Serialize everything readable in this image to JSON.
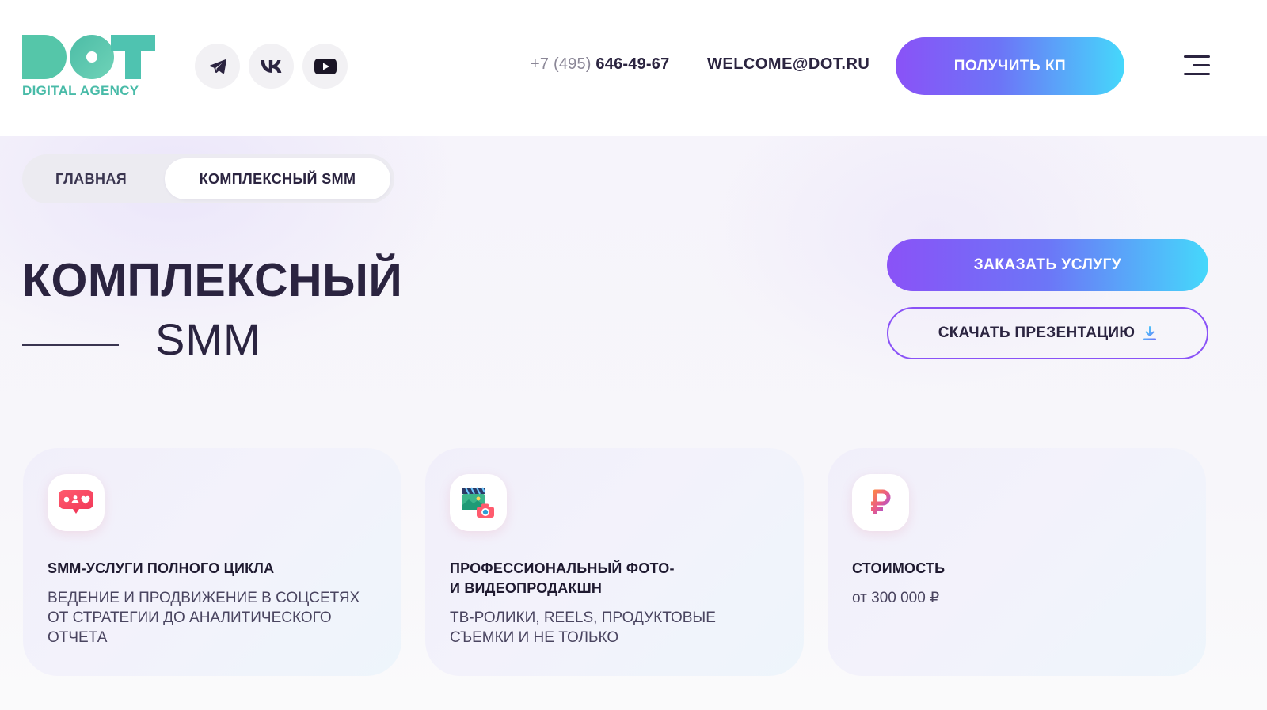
{
  "header": {
    "logo": {
      "wordmark": "DOT",
      "tagline": "DIGITAL AGENCY"
    },
    "socials": [
      {
        "name": "telegram",
        "icon": "telegram-icon"
      },
      {
        "name": "vk",
        "icon": "vk-icon"
      },
      {
        "name": "youtube",
        "icon": "youtube-icon"
      }
    ],
    "phone": {
      "code": "+7 (495)",
      "number": "646-49-67"
    },
    "email": "WELCOME@DOT.RU",
    "cta_label": "ПОЛУЧИТЬ КП",
    "menu_icon": "burger-menu-icon"
  },
  "breadcrumb": {
    "home": "ГЛАВНАЯ",
    "current": "КОМПЛЕКСНЫЙ SMM"
  },
  "hero": {
    "title_line1": "КОМПЛЕКСНЫЙ",
    "title_line2": "SMM",
    "order_label": "ЗАКАЗАТЬ УСЛУГУ",
    "download_label": "СКАЧАТЬ ПРЕЗЕНТАЦИЮ",
    "download_icon": "download-icon"
  },
  "cards": [
    {
      "icon": "social-chat-icon",
      "title": [
        "SMM-УСЛУГИ ПОЛНОГО ЦИКЛА"
      ],
      "desc": [
        "ВЕДЕНИЕ И ПРОДВИЖЕНИЕ В СОЦСЕТЯХ",
        "ОТ СТРАТЕГИИ ДО АНАЛИТИЧЕСКОГО",
        "ОТЧЕТА"
      ]
    },
    {
      "icon": "video-production-icon",
      "title": [
        "ПРОФЕССИОНАЛЬНЫЙ ФОТО-",
        "И ВИДЕОПРОДАКШН"
      ],
      "desc": [
        "ТВ-РОЛИКИ, REELS, ПРОДУКТОВЫЕ",
        "СЪЕМКИ И НЕ ТОЛЬКО"
      ]
    },
    {
      "icon": "ruble-icon",
      "title": [
        "СТОИМОСТЬ"
      ],
      "desc": [
        "от 300 000 ₽"
      ]
    }
  ],
  "colors": {
    "brand_green": "#4fc3b0",
    "gradient_start": "#8a52f7",
    "gradient_end": "#45d8fb",
    "text_dark": "#2b2440"
  }
}
